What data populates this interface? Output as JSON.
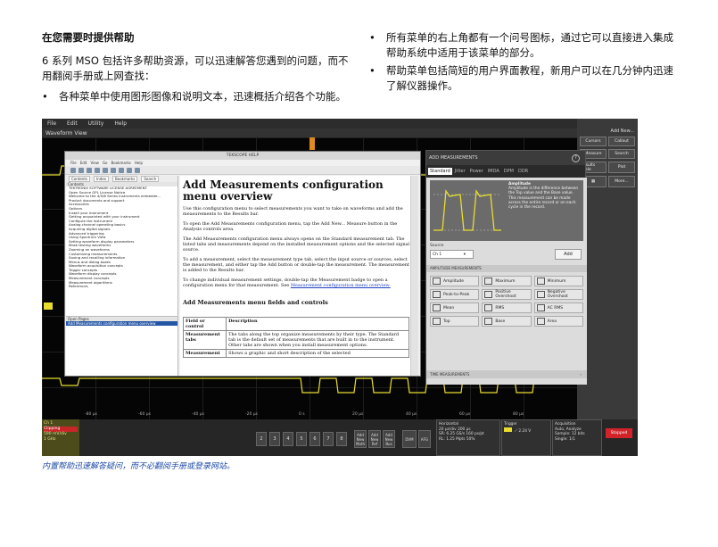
{
  "doc": {
    "heading": "在您需要时提供帮助",
    "intro": "6 系列 MSO 包括许多帮助资源，可以迅速解答您遇到的问题，而不用翻阅手册或上网查找：",
    "left_bullets": [
      "各种菜单中使用图形图像和说明文本，迅速概括介绍各个功能。"
    ],
    "right_bullets": [
      "所有菜单的右上角都有一个问号图标，通过它可以直接进入集成帮助系统中适用于该菜单的部分。",
      "帮助菜单包括简短的用户界面教程，新用户可以在几分钟内迅速了解仪器操作。"
    ],
    "caption": "内置帮助迅速解答疑问，而不必翻阅手册或登录网站。"
  },
  "scope": {
    "menubar": [
      "File",
      "Edit",
      "Utility",
      "Help"
    ],
    "waveform_view": "Waveform View",
    "right_panel": {
      "title": "Add New...",
      "buttons": [
        [
          "Cursors",
          "Callout"
        ],
        [
          "Measure",
          "Search"
        ],
        [
          "Results Table",
          "Plot"
        ],
        [
          "",
          "More..."
        ]
      ]
    },
    "help_window": {
      "title": "TEKSCOPE HELP",
      "menu": [
        "File",
        "Edit",
        "View",
        "Go",
        "Bookmarks",
        "Help"
      ],
      "tabs": [
        "Contents",
        "Index",
        "Bookmarks",
        "Search"
      ],
      "contents_label": "Contents",
      "toc": [
        "TEKTRONIX SOFTWARE LICENSE AGREEMENT",
        "Open Source GPL License Notice",
        "Welcome to the 4/5/6 Series Instruments embedde...",
        "Product documents and support",
        "Accessories",
        "Options",
        "Install your instrument",
        "Getting acquainted with your instrument",
        "Configure the instrument",
        "Analog channel operating basics",
        "Acquiring digital signals",
        "Advanced triggering",
        "Using Spectrum View",
        "Setting waveform display parameters",
        "Mask testing waveforms",
        "Zooming on waveforms",
        "Customizing measurements",
        "Saving and recalling information",
        "Menus and dialog boxes",
        "Waveform acquisition concepts",
        "Trigger concepts",
        "Waveform display concepts",
        "Measurement concepts",
        "Measurement algorithms",
        "References"
      ],
      "open_pages_label": "Open Pages",
      "open_page": "Add Measurements configuration menu overview",
      "page_title": "Add Measurements configuration menu overview",
      "paragraphs": [
        "Use this configuration menu to select measurements you want to take on waveforms and add the measurements to the Results bar.",
        "To open the Add Measurements configuration menu, tap the Add New... Measure button in the Analysis controls area.",
        "The Add Measurements configuration menu always opens on the Standard measurement tab. The listed tabs and measurements depend on the installed measurement options and the selected signal source.",
        "To add a measurement, select the measurement type tab, select the input source or sources, select the measurement, and either tap the Add button or double-tap the measurement. The measurement is added to the Results bar."
      ],
      "last_paragraph": "To change individual measurement settings, double-tap the Measurement badge to open a configuration menu for that measurement. See",
      "last_link": "Measurement configuration menu overview.",
      "section_title": "Add Measurements menu fields and controls",
      "table": {
        "headers": [
          "Field or control",
          "Description"
        ],
        "rows": [
          [
            "Measurement tabs",
            "The tabs along the top organize measurements by their type. The Standard tab is the default set of measurements that are built in to the instrument. Other tabs are shown when you install measurement options."
          ],
          [
            "Measurement",
            "Shows a graphic and short description of the selected"
          ]
        ]
      }
    },
    "measure_panel": {
      "title": "ADD MEASUREMENTS",
      "help_icon": "?",
      "tabs": [
        "Standard",
        "Jitter",
        "Power",
        "IMDA",
        "DPM",
        "DDR"
      ],
      "preview_title": "Amplitude",
      "preview_text": "Amplitude is the difference between the Top value and the Base value. This measurement can be made across the entire record or on each cycle in the record.",
      "source_label": "Source",
      "source_value": "Ch 1",
      "add_label": "Add",
      "amp_header": "AMPLITUDE MEASUREMENTS",
      "amp_items": [
        "Amplitude",
        "Maximum",
        "Minimum",
        "Peak-to-Peak",
        "Positive Overshoot",
        "Negative Overshoot",
        "Mean",
        "RMS",
        "AC RMS",
        "Top",
        "Base",
        "Area"
      ],
      "time_header": "TIME MEASUREMENTS"
    },
    "time_axis": [
      "-80 µs",
      "-60 µs",
      "-40 µs",
      "-20 µs",
      "0 s",
      "20 µs",
      "40 µs",
      "60 µs",
      "80 µs"
    ],
    "ch1": {
      "label": "Ch 1",
      "clipping": "Clipping",
      "scale": "590 mV/div",
      "bw": "1 GHz"
    },
    "channel_buttons": [
      "2",
      "3",
      "4",
      "5",
      "6",
      "7",
      "8"
    ],
    "add_buttons": [
      "Add New Math",
      "Add New Ref",
      "Add New Bus"
    ],
    "dvm": "DVM",
    "afg": "AFG",
    "horizontal": {
      "title": "Horizontal",
      "lines": [
        "20 µs/div    200 µs",
        "SR: 6.25 GS/s   160 ps/pt",
        "RL: 1.25 Mpts   50%"
      ]
    },
    "trigger": {
      "title": "Trigger",
      "value": "2.24 V"
    },
    "acquisition": {
      "title": "Acquisition",
      "lines": [
        "Auto,        Analyze",
        "Sample: 12 bits",
        "Single: 1/1"
      ]
    },
    "status": "Stopped",
    "colors": {
      "ch1": "#e8dd2e",
      "accent": "#2456a6",
      "stopped": "#d3232a",
      "caption": "#1f4aa5"
    }
  }
}
